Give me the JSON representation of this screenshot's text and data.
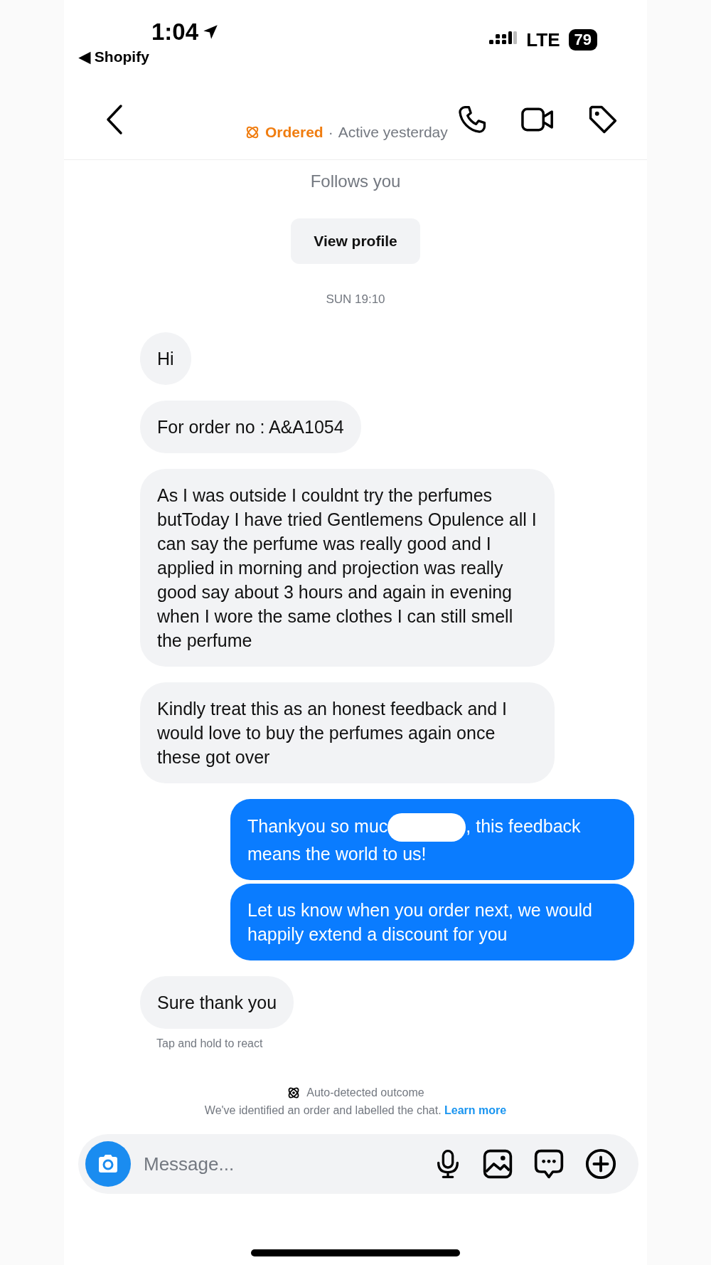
{
  "status_bar": {
    "time": "1:04",
    "back_app": "◀ Shopify",
    "network": "LTE",
    "battery": "79"
  },
  "header": {
    "order_label": "Ordered",
    "separator": "·",
    "activity": "Active yesterday"
  },
  "profile": {
    "follows": "Follows you",
    "button": "View profile"
  },
  "timestamp": "SUN 19:10",
  "messages": [
    {
      "kind": "incoming",
      "text": "Hi"
    },
    {
      "kind": "incoming",
      "text": "For order no : A&A1054"
    },
    {
      "kind": "incoming",
      "text": "As I was outside I couldnt try the perfumes butToday I have tried Gentlemens Opulence all I can say the perfume was really good and I applied in morning and projection was really good say about 3 hours and again in evening when I wore the same clothes I can still smell the perfume"
    },
    {
      "kind": "incoming",
      "text": "Kindly treat this as an honest feedback and I would love to buy the perfumes again once these got over"
    },
    {
      "kind": "outgoing",
      "text": "Thankyou so muc",
      "redacted": true,
      "text_after": ", this feedback means the world to us!"
    },
    {
      "kind": "outgoing",
      "text": "Let us know when you order next, we would happily extend a discount for you"
    },
    {
      "kind": "incoming",
      "text": "Sure thank you"
    }
  ],
  "hint": "Tap and hold to react",
  "notice": {
    "title": "Auto-detected outcome",
    "text": "We've identified an order and labelled the chat.",
    "link": "Learn more"
  },
  "composer": {
    "placeholder": "Message..."
  }
}
